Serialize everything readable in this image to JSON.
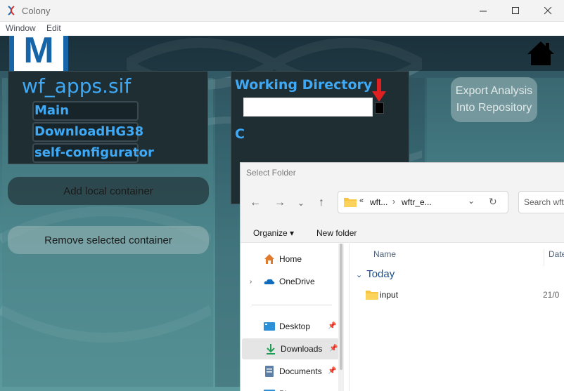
{
  "window": {
    "title": "Colony",
    "app_icon": "dna-icon"
  },
  "window_controls": {
    "minimize": "─",
    "maximize": "☐",
    "close": "✕"
  },
  "menu": {
    "items": [
      "Window",
      "Edit"
    ]
  },
  "header": {
    "logo_letter": "M",
    "home_icon": "home-icon"
  },
  "containers": {
    "title": "wf_apps.sif",
    "items": [
      "Main",
      "DownloadHG38",
      "self-configurator"
    ]
  },
  "buttons": {
    "add_container": "Add local container",
    "remove_container": "Remove selected container",
    "export": "Export Analysis Into Repository"
  },
  "working_directory": {
    "title": "Working Directory",
    "value": "",
    "partial_label": "C"
  },
  "dialog": {
    "title": "Select Folder",
    "nav": {
      "back": "←",
      "forward": "→",
      "recent": "⌄",
      "up": "↑"
    },
    "address": {
      "prefix": "«",
      "segment1": "wft...",
      "separator": "›",
      "segment2": "wftr_e...",
      "dropdown": "⌄",
      "refresh": "↻"
    },
    "search_placeholder": "Search wftu",
    "toolbar": {
      "organize": "Organize ▾",
      "new_folder": "New folder"
    },
    "sidebar": {
      "home": "Home",
      "onedrive": "OneDrive",
      "desktop": "Desktop",
      "downloads": "Downloads",
      "documents": "Documents",
      "pictures": "Pi"
    },
    "columns": {
      "name": "Name",
      "date": "Date"
    },
    "groups": [
      {
        "label": "Today",
        "files": [
          {
            "name": "input",
            "date": "21/0"
          }
        ]
      }
    ]
  }
}
